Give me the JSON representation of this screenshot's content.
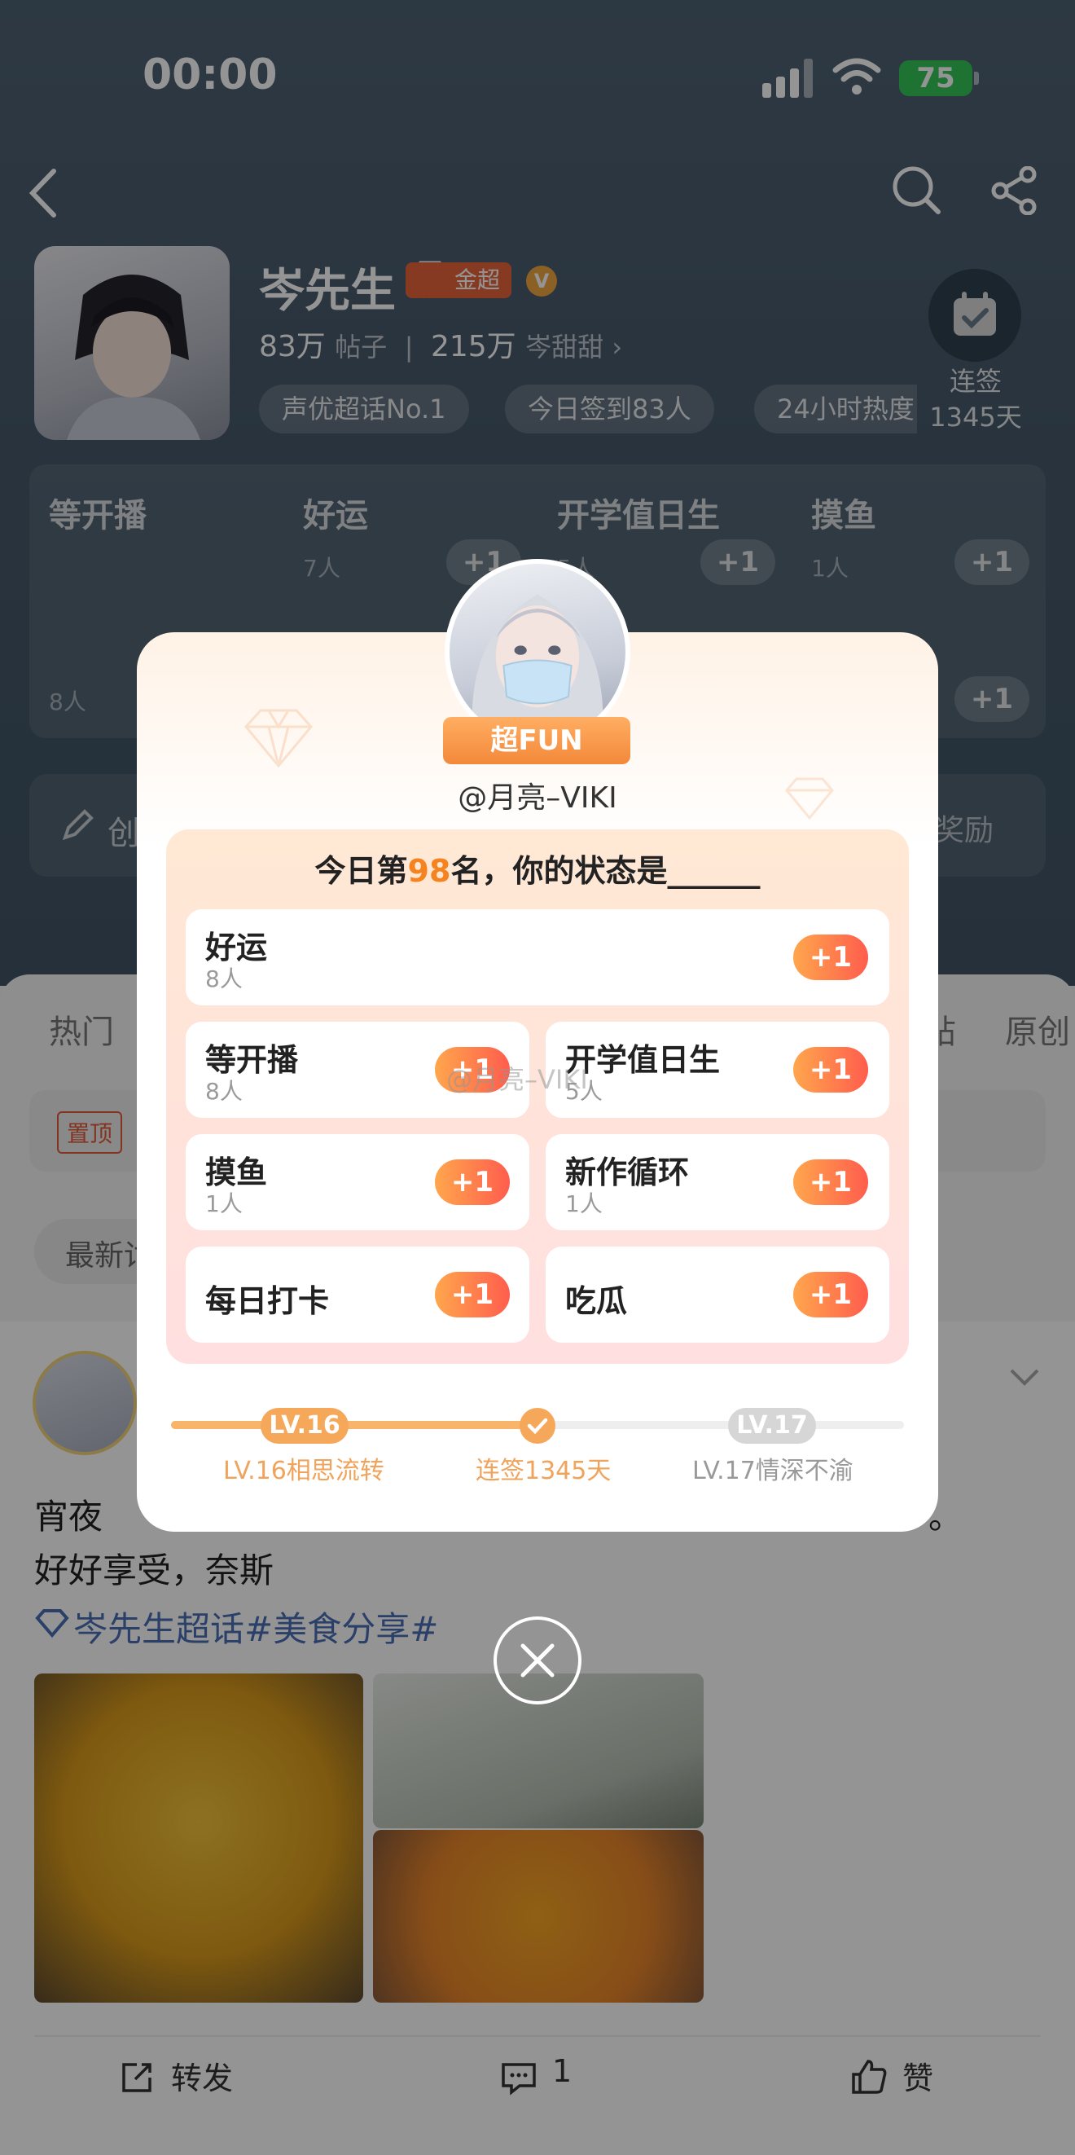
{
  "status": {
    "time": "00:00",
    "battery": "75"
  },
  "header": {
    "title": "岑先生",
    "tier_badge": "金超",
    "posts_count": "83万",
    "posts_label": "帖子",
    "fans_count": "215万",
    "fans_label": "岑甜甜",
    "chips": [
      "声优超话No.1",
      "今日签到83人",
      "24小时热度"
    ],
    "checkin_label": "连签",
    "checkin_days": "1345天"
  },
  "status_grid": [
    {
      "label": "等开播",
      "count": "8人"
    },
    {
      "label": "好运",
      "count": "7人"
    },
    {
      "label": "开学值日生",
      "count": "5人"
    },
    {
      "label": "摸鱼",
      "count": "1人"
    }
  ],
  "create_bar": {
    "left": "创",
    "right": "奖励"
  },
  "tabs": [
    "热门",
    "帖",
    "原创"
  ],
  "pin_label": "置顶",
  "sort_label": "最新讨",
  "post": {
    "line1": "宵夜",
    "line1_end": "。",
    "line2": "好好享受，奈斯",
    "topic": "岑先生超话#美食分享#",
    "actions": {
      "share": "转发",
      "comment": "1",
      "like": "赞"
    }
  },
  "modal": {
    "badge": "超FUN",
    "username": "@月亮–VIKI",
    "title_prefix": "今日第",
    "rank": "98",
    "title_suffix": "名，你的状态是______",
    "plus_label": "+1",
    "options": [
      {
        "label": "好运",
        "count": "8人"
      },
      {
        "label": "等开播",
        "count": "8人"
      },
      {
        "label": "开学值日生",
        "count": "5人"
      },
      {
        "label": "摸鱼",
        "count": "1人"
      },
      {
        "label": "新作循环",
        "count": "1人"
      },
      {
        "label": "每日打卡",
        "count": ""
      },
      {
        "label": "吃瓜",
        "count": ""
      }
    ],
    "watermark": "@月亮–VIKI",
    "progress": {
      "current_pill": "LV.16",
      "next_pill": "LV.17",
      "current_label": "LV.16相思流转",
      "mid_label": "连签1345天",
      "next_label": "LV.17情深不渝"
    }
  },
  "colors": {
    "accent": "#f5831f",
    "plus_gradient": [
      "#ffa64d",
      "#ff5d4d"
    ],
    "topic_link": "#4a6fb6"
  }
}
